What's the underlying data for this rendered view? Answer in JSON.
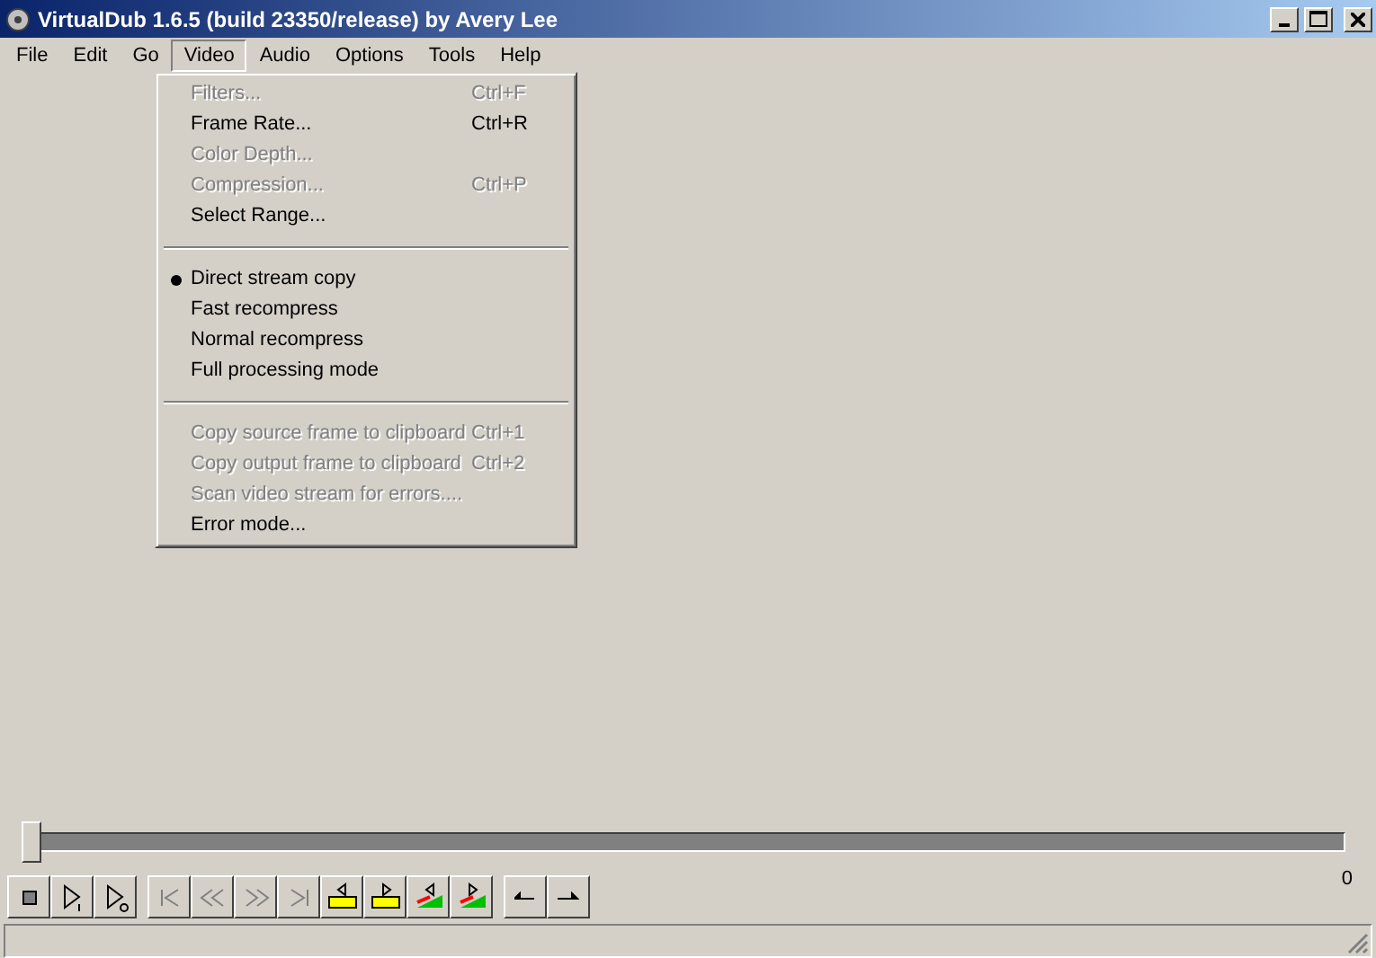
{
  "window": {
    "title": "VirtualDub 1.6.5 (build 23350/release) by Avery Lee"
  },
  "menu_bar": [
    {
      "label": "File",
      "selected": false
    },
    {
      "label": "Edit",
      "selected": false
    },
    {
      "label": "Go",
      "selected": false
    },
    {
      "label": "Video",
      "selected": true
    },
    {
      "label": "Audio",
      "selected": false
    },
    {
      "label": "Options",
      "selected": false
    },
    {
      "label": "Tools",
      "selected": false
    },
    {
      "label": "Help",
      "selected": false
    }
  ],
  "video_menu": [
    {
      "kind": "item",
      "label": "Filters...",
      "shortcut": "Ctrl+F",
      "disabled": true,
      "checked": false
    },
    {
      "kind": "item",
      "label": "Frame Rate...",
      "shortcut": "Ctrl+R",
      "disabled": false,
      "checked": false
    },
    {
      "kind": "item",
      "label": "Color Depth...",
      "disabled": true,
      "checked": false
    },
    {
      "kind": "item",
      "label": "Compression...",
      "shortcut": "Ctrl+P",
      "disabled": true,
      "checked": false
    },
    {
      "kind": "item",
      "label": "Select Range...",
      "disabled": false,
      "checked": false
    },
    {
      "kind": "separator"
    },
    {
      "kind": "item",
      "label": "Direct stream copy",
      "disabled": false,
      "checked": true
    },
    {
      "kind": "item",
      "label": "Fast recompress",
      "disabled": false,
      "checked": false
    },
    {
      "kind": "item",
      "label": "Normal recompress",
      "disabled": false,
      "checked": false
    },
    {
      "kind": "item",
      "label": "Full processing mode",
      "disabled": false,
      "checked": false
    },
    {
      "kind": "separator"
    },
    {
      "kind": "item",
      "label": "Copy source frame to clipboard",
      "shortcut": "Ctrl+1",
      "disabled": true,
      "checked": false
    },
    {
      "kind": "item",
      "label": "Copy output frame to clipboard",
      "shortcut": "Ctrl+2",
      "disabled": true,
      "checked": false
    },
    {
      "kind": "item",
      "label": "Scan video stream for errors....",
      "disabled": true,
      "checked": false
    },
    {
      "kind": "item",
      "label": "Error mode...",
      "disabled": false,
      "checked": false
    }
  ],
  "position_slider": {
    "level": 0,
    "end_label": "0"
  },
  "toolbar": [
    [
      {
        "kind": "stop"
      },
      {
        "kind": "play-input"
      },
      {
        "kind": "play-output"
      }
    ],
    [
      {
        "kind": "start"
      },
      {
        "kind": "prev-key"
      },
      {
        "kind": "next-key"
      },
      {
        "kind": "end"
      },
      {
        "kind": "mark-in"
      },
      {
        "kind": "mark-out"
      },
      {
        "kind": "scene-prev"
      },
      {
        "kind": "scene-next"
      }
    ],
    [
      {
        "kind": "prev-frame"
      },
      {
        "kind": "next-frame"
      }
    ]
  ]
}
